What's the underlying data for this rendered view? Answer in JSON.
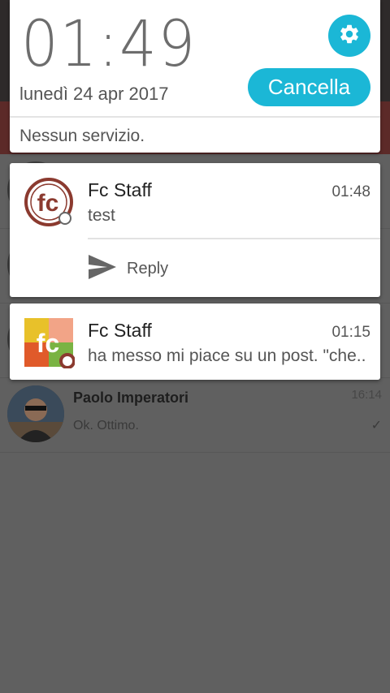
{
  "background_app": {
    "conversation": {
      "name": "Paolo Imperatori",
      "time": "16:14",
      "last_message": "Ok. Ottimo.",
      "check_glyph": "✓"
    }
  },
  "header": {
    "clock": "01:49",
    "date": "lunedì 24 apr 2017",
    "settings_icon": "gear-icon",
    "clear_label": "Cancella",
    "network_status": "Nessun servizio."
  },
  "notifications": [
    {
      "app_icon": "fc-logo-circle",
      "title": "Fc Staff",
      "time": "01:48",
      "text": "test",
      "actions": [
        {
          "icon": "send-icon",
          "label": "Reply"
        }
      ]
    },
    {
      "app_icon": "fc-logo-square",
      "title": "Fc Staff",
      "time": "01:15",
      "text": "ha messo mi piace su un post. \"che.."
    }
  ],
  "colors": {
    "accent": "#1bb7d6",
    "brand_red": "#8b3a2f",
    "scrim": "#606060"
  }
}
